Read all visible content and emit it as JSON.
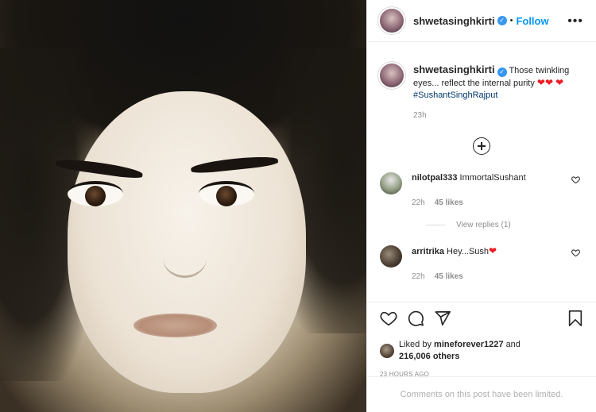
{
  "post": {
    "username": "shwetasinghkirti",
    "follow_label": "Follow",
    "separator": "•",
    "more_label": "•••",
    "verified_mark": "✓",
    "caption": {
      "username": "shwetasinghkirti",
      "text": "Those twinkling eyes... reflect the internal purity",
      "hearts_a": "❤❤",
      "hearts_b": "❤",
      "hashtag": "#SushantSinghRajput",
      "time": "23h"
    },
    "comments": [
      {
        "username": "nilotpal333",
        "text": "ImmortalSushant",
        "time": "22h",
        "likes": "45 likes",
        "view_replies": "View replies (1)"
      },
      {
        "username": "arritrika",
        "text": "Hey...Sush",
        "heart": "❤",
        "time": "22h",
        "likes": "45 likes"
      }
    ],
    "liked_by": {
      "prefix": "Liked by",
      "user": "mineforever1227",
      "and": "and",
      "others": "216,006 others"
    },
    "posted_ago": "23 HOURS AGO",
    "comments_limited": "Comments on this post have been limited.",
    "icons": {
      "like": "heart-icon",
      "comment": "comment-icon",
      "share": "paper-plane-icon",
      "save": "bookmark-icon",
      "load_more": "plus-circle-icon"
    },
    "colors": {
      "link_blue": "#0095f6",
      "hashtag": "#00376b",
      "heart_red": "#ed1c24",
      "muted": "#8e8e8e"
    }
  }
}
